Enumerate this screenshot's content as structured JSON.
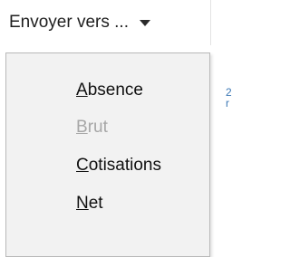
{
  "toolbar": {
    "send_to_label": "Envoyer vers ...",
    "dropdown_icon": "chevron-down-icon"
  },
  "menu": {
    "items": [
      {
        "mnemonic": "A",
        "rest": "bsence",
        "enabled": true
      },
      {
        "mnemonic": "B",
        "rest": "rut",
        "enabled": false
      },
      {
        "mnemonic": "C",
        "rest": "otisations",
        "enabled": true
      },
      {
        "mnemonic": "N",
        "rest": "et",
        "enabled": true
      }
    ]
  },
  "background": {
    "glyph_1": "2",
    "glyph_2": "r"
  },
  "colors": {
    "menu_background": "#f2f2f2",
    "menu_border": "#b9b9b9",
    "text": "#111111",
    "disabled_text": "#a7a7a7",
    "background_link": "#3c78b5"
  }
}
